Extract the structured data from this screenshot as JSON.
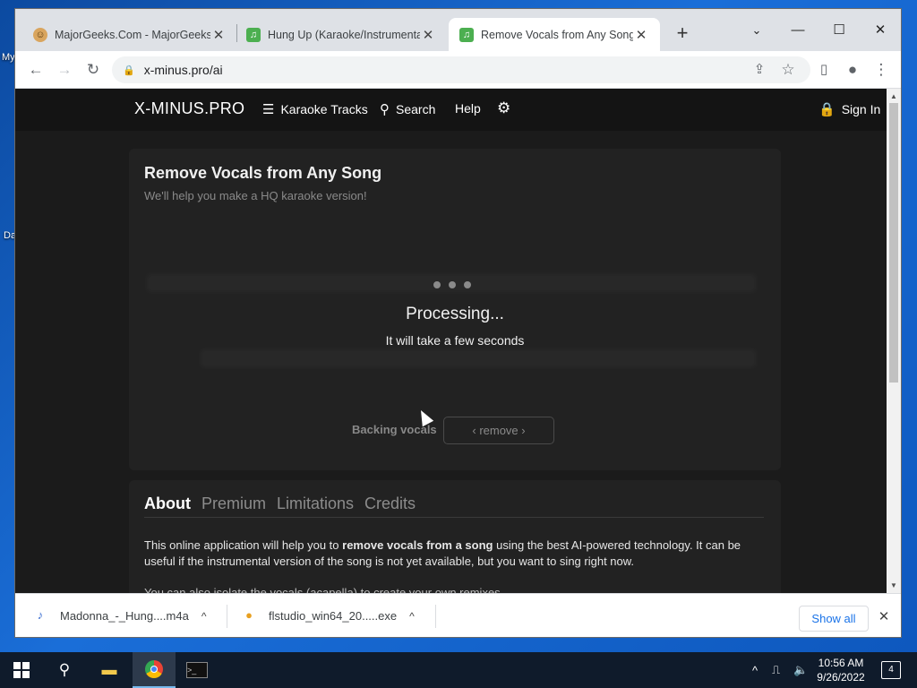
{
  "desktop": {
    "labels": [
      "My",
      "Da"
    ]
  },
  "browser": {
    "tabs": [
      {
        "title": "MajorGeeks.Com - MajorGeeks",
        "icon": "majorgeeks-favicon"
      },
      {
        "title": "Hung Up (Karaoke/Instrumental)",
        "icon": "music-note-favicon"
      },
      {
        "title": "Remove Vocals from Any Song",
        "icon": "music-note-favicon",
        "active": true
      }
    ],
    "url": "x-minus.pro/ai"
  },
  "site": {
    "logo": "X-MINUS.PRO",
    "nav": {
      "karaoke": "Karaoke Tracks",
      "search": "Search",
      "help": "Help",
      "signin": "Sign In"
    }
  },
  "tool": {
    "title": "Remove Vocals from Any Song",
    "subtitle": "We'll help you make a HQ karaoke version!",
    "processing_title": "Processing...",
    "processing_sub": "It will take a few seconds",
    "backing_label": "Backing vocals",
    "remove_label": "‹ remove ›"
  },
  "info": {
    "tabs": [
      "About",
      "Premium",
      "Limitations",
      "Credits"
    ],
    "about_before": "This online application will help you to ",
    "about_bold": "remove vocals from a song",
    "about_after": " using the best AI-powered technology. It can be useful if the instrumental version of the song is not yet available, but you want to sing right now.",
    "about_line2": "You can also isolate the vocals (acapella) to create your own remixes."
  },
  "downloads": {
    "items": [
      {
        "name": "Madonna_-_Hung....m4a",
        "icon": "audio-file-icon"
      },
      {
        "name": "flstudio_win64_20.....exe",
        "icon": "flstudio-icon"
      }
    ],
    "show_all": "Show all"
  },
  "taskbar": {
    "time": "10:56 AM",
    "date": "9/26/2022",
    "notifications": "4"
  }
}
